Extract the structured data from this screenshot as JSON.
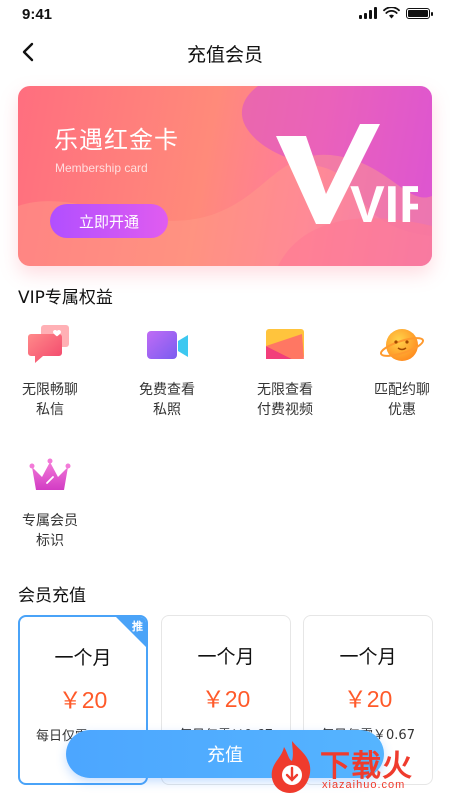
{
  "status_bar": {
    "time": "9:41",
    "battery_level": 1.0
  },
  "nav": {
    "title": "充值会员",
    "back_icon": "chevron-left-icon"
  },
  "card": {
    "title": "乐遇红金卡",
    "subtitle": "Membership card",
    "button_label": "立即开通",
    "logo_text": "VIP",
    "colors": {
      "start": "#ff6e7f",
      "end": "#e05cd6",
      "button": "#b14fff"
    }
  },
  "benefits": {
    "title": "VIP专属权益",
    "items": [
      {
        "icon": "chat-heart-icon",
        "label": "无限畅聊\n私信"
      },
      {
        "icon": "video-camera-icon",
        "label": "免费查看\n私照"
      },
      {
        "icon": "photo-video-icon",
        "label": "无限查看\n付费视频"
      },
      {
        "icon": "planet-icon",
        "label": "匹配约聊\n优惠"
      },
      {
        "icon": "crown-icon",
        "label": "专属会员\n标识"
      }
    ]
  },
  "recharge": {
    "title": "会员充值",
    "badge_text": "推",
    "selected_index": 0,
    "plans": [
      {
        "duration": "一个月",
        "price": "￥20",
        "daily": "每日仅需￥0.67"
      },
      {
        "duration": "一个月",
        "price": "￥20",
        "daily": "每日仅需￥0.67"
      },
      {
        "duration": "一个月",
        "price": "￥20",
        "daily": "每日仅需￥0.67"
      }
    ],
    "button_label": "充值",
    "accent_color": "#4aa3f8",
    "price_color": "#ff5a2a"
  },
  "watermark": {
    "text": "下载火",
    "sub": "xiazaihuo.com",
    "color": "#ef3b2d"
  }
}
